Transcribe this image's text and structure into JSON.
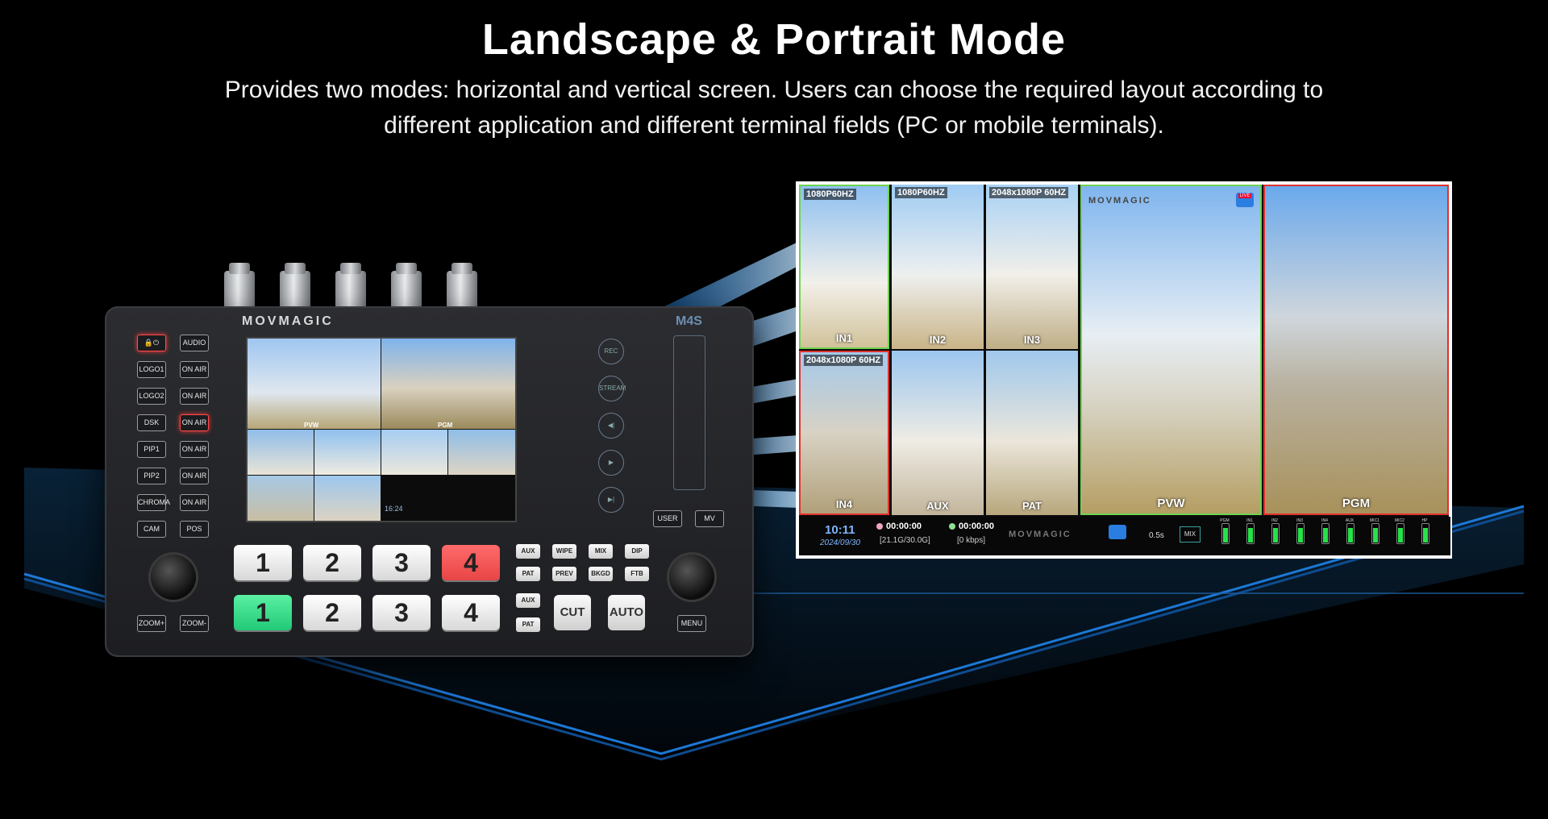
{
  "header": {
    "title": "Landscape & Portrait Mode",
    "subtitle_line1": "Provides two modes: horizontal and vertical screen. Users can choose the required layout according to",
    "subtitle_line2": "different application and different terminal fields (PC or mobile terminals)."
  },
  "device": {
    "brand": "MOVMAGIC",
    "model": "M4S",
    "side_buttons_left": [
      "LOGO1",
      "LOGO2",
      "DSK",
      "PIP1",
      "PIP2",
      "CHROMA",
      "CAM"
    ],
    "side_buttons_right": [
      "AUDIO",
      "ON AIR",
      "ON AIR",
      "ON AIR",
      "ON AIR",
      "ON AIR",
      "ON AIR",
      "POS"
    ],
    "zoom_plus": "ZOOM+",
    "zoom_minus": "ZOOM-",
    "round_buttons": [
      "REC",
      "STREAM",
      "◀|",
      "▶",
      "▶|"
    ],
    "user": "USER",
    "mv": "MV",
    "menu": "MENU",
    "pvw_keys": [
      "1",
      "2",
      "3",
      "4"
    ],
    "pgm_keys": [
      "1",
      "2",
      "3",
      "4"
    ],
    "trans_row1": [
      "AUX",
      "WIPE",
      "MIX",
      "DIP"
    ],
    "trans_row2": [
      "PAT",
      "PREV",
      "BKGD",
      "FTB"
    ],
    "trans_row3": [
      "AUX"
    ],
    "trans_row4": [
      "PAT"
    ],
    "cut": "CUT",
    "auto": "AUTO",
    "screen": {
      "time": "16:24",
      "pvw": "PVW",
      "pgm": "PGM"
    }
  },
  "multiview": {
    "cells": [
      {
        "top": "1080P60HZ",
        "bottom": "IN1"
      },
      {
        "top": "1080P60HZ",
        "bottom": "IN2"
      },
      {
        "top": "2048x1080P 60HZ",
        "bottom": "IN3"
      },
      {
        "top": "2048x1080P 60HZ",
        "bottom": "IN4"
      },
      {
        "top": "",
        "bottom": "AUX"
      },
      {
        "top": "",
        "bottom": "PAT"
      }
    ],
    "pvw_label": "PVW",
    "pgm_label": "PGM",
    "brand": "MOVMAGIC",
    "live_badge": "LIVE",
    "status": {
      "time": "10:11",
      "date": "2024/09/30",
      "rec_time": "00:00:00",
      "storage": "[21.1G/30.0G]",
      "stream_time": "00:00:00",
      "bitrate": "[0 kbps]",
      "transition_duration": "0.5s",
      "transition_type": "MIX"
    },
    "meters": [
      "PGM",
      "IN1",
      "IN2",
      "IN3",
      "IN4",
      "AUX",
      "MIC1",
      "MIC2",
      "HP"
    ]
  },
  "colors": {
    "background": "#000000",
    "floor_blue": "#0d4a8a",
    "pvw_border": "#6fd34f",
    "pgm_border": "#e0312d",
    "meter_green": "#26e34a"
  }
}
